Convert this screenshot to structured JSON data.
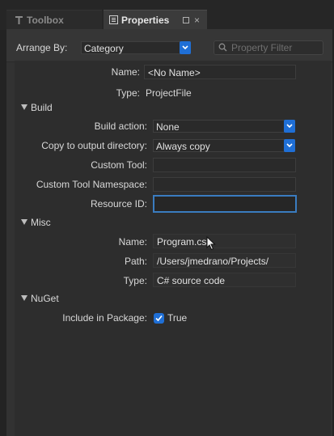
{
  "tabs": [
    {
      "label": "Toolbox",
      "icon": "toolbox-icon"
    },
    {
      "label": "Properties",
      "icon": "properties-icon"
    }
  ],
  "toolbar": {
    "arrange_label": "Arrange By:",
    "arrange_value": "Category",
    "filter_placeholder": "Property Filter"
  },
  "top": {
    "name_label": "Name:",
    "name_value": "<No Name>",
    "type_label": "Type:",
    "type_value": "ProjectFile"
  },
  "build": {
    "header": "Build",
    "build_action_label": "Build action:",
    "build_action_value": "None",
    "copy_label": "Copy to output directory:",
    "copy_value": "Always copy",
    "custom_tool_label": "Custom Tool:",
    "custom_tool_value": "",
    "namespace_label": "Custom Tool Namespace:",
    "namespace_value": "",
    "resource_label": "Resource ID:",
    "resource_value": ""
  },
  "misc": {
    "header": "Misc",
    "name_label": "Name:",
    "name_value": "Program.cs",
    "path_label": "Path:",
    "path_value": "/Users/jmedrano/Projects/",
    "type_label": "Type:",
    "type_value": "C# source code"
  },
  "nuget": {
    "header": "NuGet",
    "include_label": "Include in Package:",
    "include_checked": true,
    "include_value": "True"
  },
  "colors": {
    "accent": "#1f6fd6",
    "focus_border": "#3a7cc0",
    "background": "#2d2d2d"
  }
}
